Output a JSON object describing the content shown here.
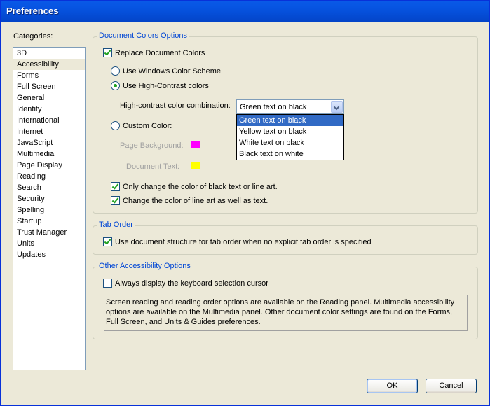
{
  "window": {
    "title": "Preferences"
  },
  "categories": {
    "label": "Categories:",
    "items": [
      "3D",
      "Accessibility",
      "Forms",
      "Full Screen",
      "General",
      "Identity",
      "International",
      "Internet",
      "JavaScript",
      "Multimedia",
      "Page Display",
      "Reading",
      "Search",
      "Security",
      "Spelling",
      "Startup",
      "Trust Manager",
      "Units",
      "Updates"
    ],
    "selected": "Accessibility"
  },
  "doc_colors": {
    "legend": "Document Colors Options",
    "replace_label": "Replace Document Colors",
    "replace_checked": true,
    "windows_scheme_label": "Use Windows Color Scheme",
    "high_contrast_label": "Use High-Contrast colors",
    "combo_label": "High-contrast color combination:",
    "combo_value": "Green text on black",
    "combo_options": [
      "Green text on black",
      "Yellow text on black",
      "White text on black",
      "Black text on white"
    ],
    "custom_label": "Custom Color:",
    "page_bg_label": "Page Background:",
    "page_bg_color": "#ff00ff",
    "doc_text_label": "Document Text:",
    "doc_text_color": "#ffff00",
    "only_black_label": "Only change the color of black text or line art.",
    "line_art_label": "Change the color of line art as well as text."
  },
  "tab_order": {
    "legend": "Tab Order",
    "structure_label": "Use document structure for tab order when no explicit tab order is specified"
  },
  "other": {
    "legend": "Other Accessibility Options",
    "cursor_label": "Always display the keyboard selection cursor",
    "info_text": "Screen reading and reading order options are available on the Reading panel. Multimedia accessibility options are available on the Multimedia panel. Other document color settings are found on the Forms, Full Screen, and Units & Guides preferences."
  },
  "buttons": {
    "ok": "OK",
    "cancel": "Cancel"
  }
}
